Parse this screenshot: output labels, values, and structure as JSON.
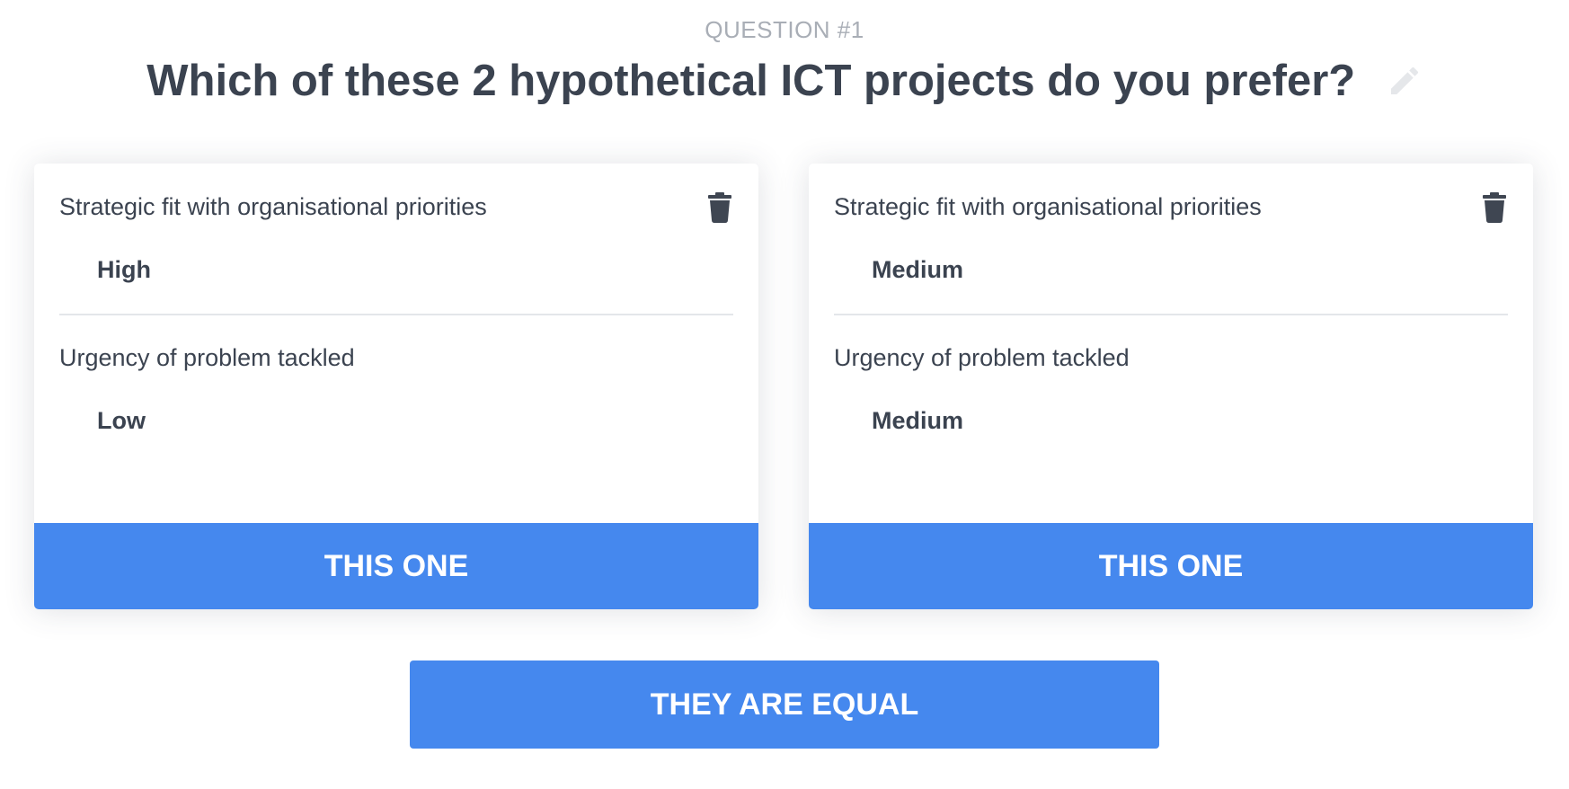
{
  "header": {
    "question_number": "QUESTION #1",
    "title": "Which of these 2 hypothetical ICT projects do you prefer?",
    "edit_icon": "pencil-icon"
  },
  "options": [
    {
      "criteria": [
        {
          "label": "Strategic fit with organisational priorities",
          "value": "High"
        },
        {
          "label": "Urgency of problem tackled",
          "value": "Low"
        }
      ],
      "delete_icon": "trash-icon",
      "button_label": "THIS ONE"
    },
    {
      "criteria": [
        {
          "label": "Strategic fit with organisational priorities",
          "value": "Medium"
        },
        {
          "label": "Urgency of problem tackled",
          "value": "Medium"
        }
      ],
      "delete_icon": "trash-icon",
      "button_label": "THIS ONE"
    }
  ],
  "equal_button_label": "THEY ARE EQUAL",
  "colors": {
    "accent": "#4588ee",
    "text": "#3b4350",
    "muted": "#a9aeb6",
    "icon_light": "#e5e7ea"
  }
}
